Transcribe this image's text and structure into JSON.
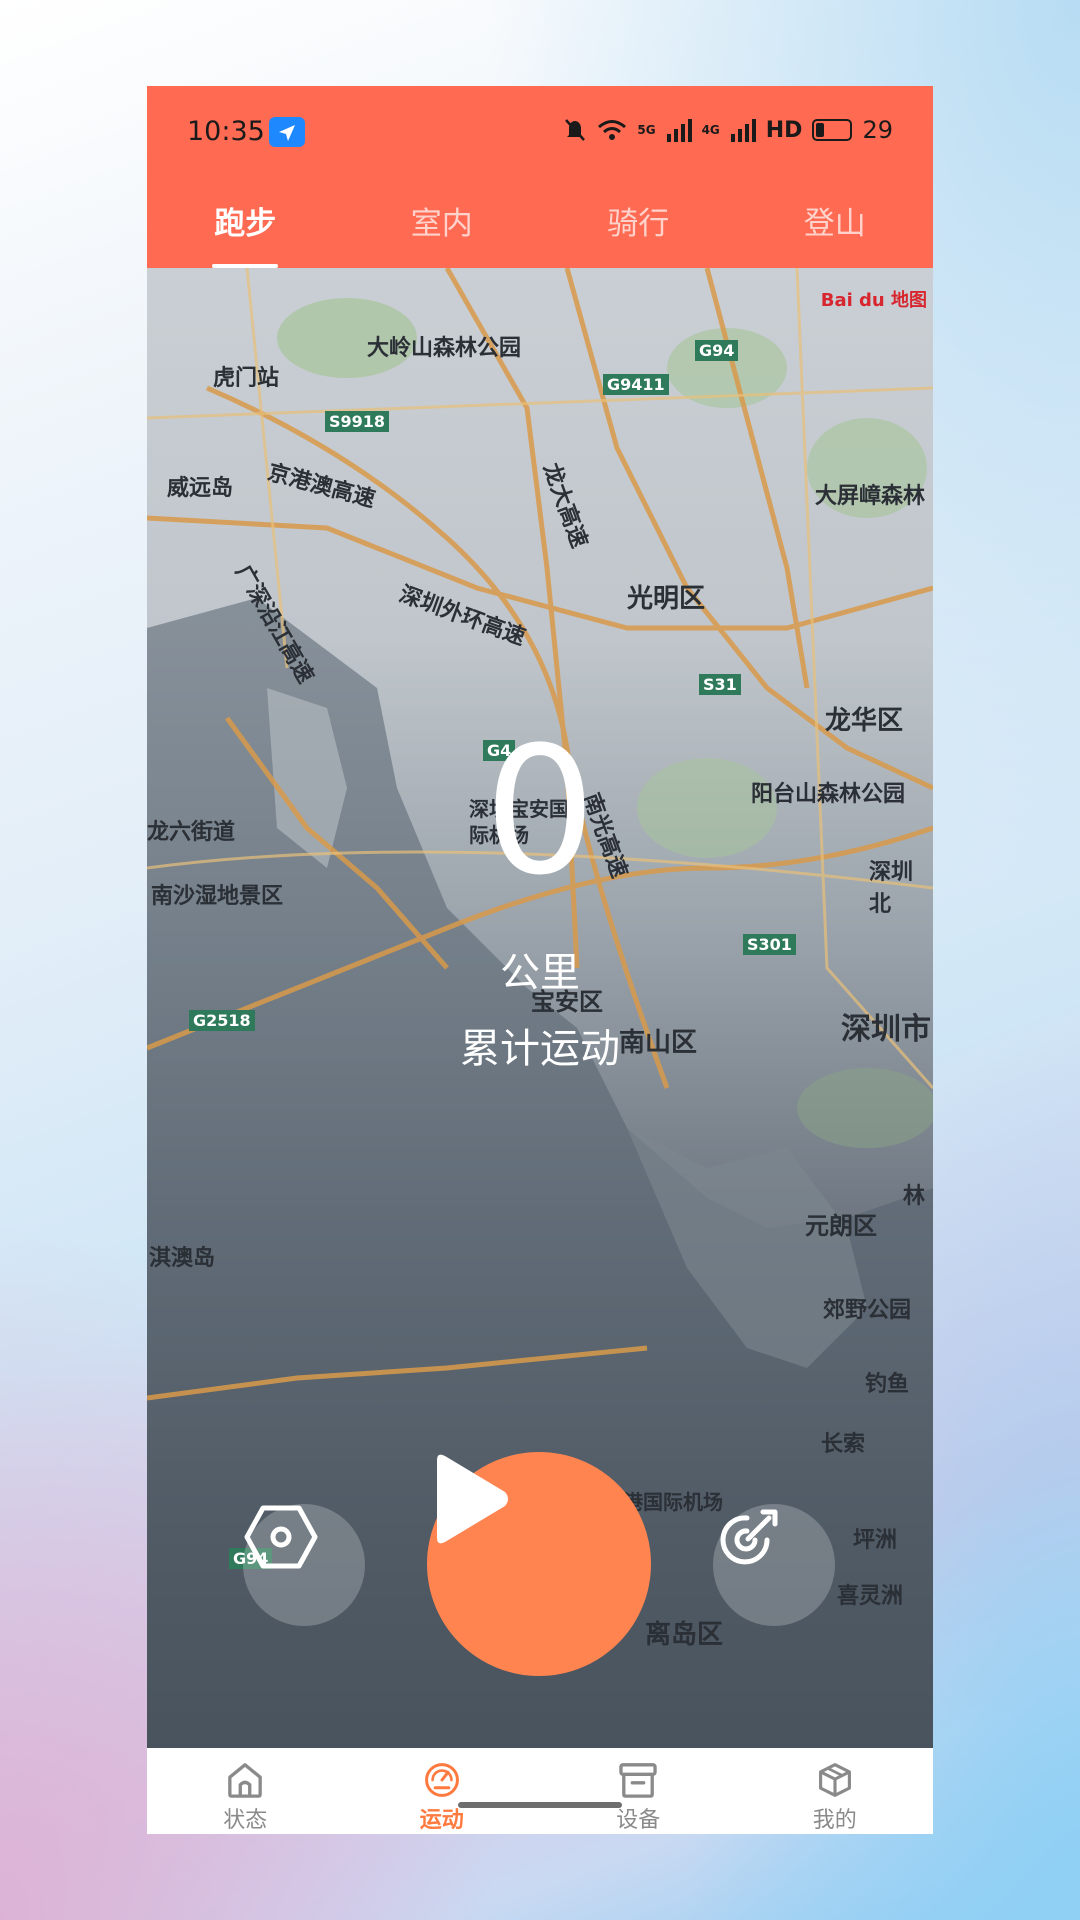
{
  "status_bar": {
    "time": "10:35",
    "network": "5G",
    "network2": "4G",
    "hd": "HD",
    "battery": "29"
  },
  "tabs": [
    {
      "label": "跑步",
      "active": true
    },
    {
      "label": "室内",
      "active": false
    },
    {
      "label": "骑行",
      "active": false
    },
    {
      "label": "登山",
      "active": false
    }
  ],
  "map": {
    "provider": "Bai du 地图",
    "labels": [
      "大岭山森林公园",
      "虎门站",
      "S9918",
      "G9411",
      "G94",
      "威远岛",
      "京港澳高速",
      "龙大高速",
      "大屏嶂森林",
      "广深沿江高速",
      "深圳外环高速",
      "光明区",
      "S31",
      "龙华区",
      "G4",
      "深圳宝安国际机场",
      "南光高速",
      "阳台山森林公园",
      "龙六街道",
      "南沙湿地景区",
      "深圳北",
      "S301",
      "G2518",
      "宝安区",
      "南山区",
      "深圳市",
      "元朗区",
      "淇澳岛",
      "郊野公园",
      "钓鱼",
      "长索",
      "香港国际机场",
      "坪洲",
      "G94",
      "喜灵洲",
      "离岛区",
      "林"
    ]
  },
  "stats": {
    "distance": "0",
    "unit": "公里",
    "subtitle": "累计运动"
  },
  "nav": [
    {
      "label": "状态",
      "icon": "home-icon",
      "active": false
    },
    {
      "label": "运动",
      "icon": "speedometer-icon",
      "active": true
    },
    {
      "label": "设备",
      "icon": "archive-box-icon",
      "active": false
    },
    {
      "label": "我的",
      "icon": "cube-icon",
      "active": false
    }
  ],
  "colors": {
    "header": "#ff6a52",
    "accent": "#ff8450",
    "nav_active": "#ff7a3e"
  }
}
